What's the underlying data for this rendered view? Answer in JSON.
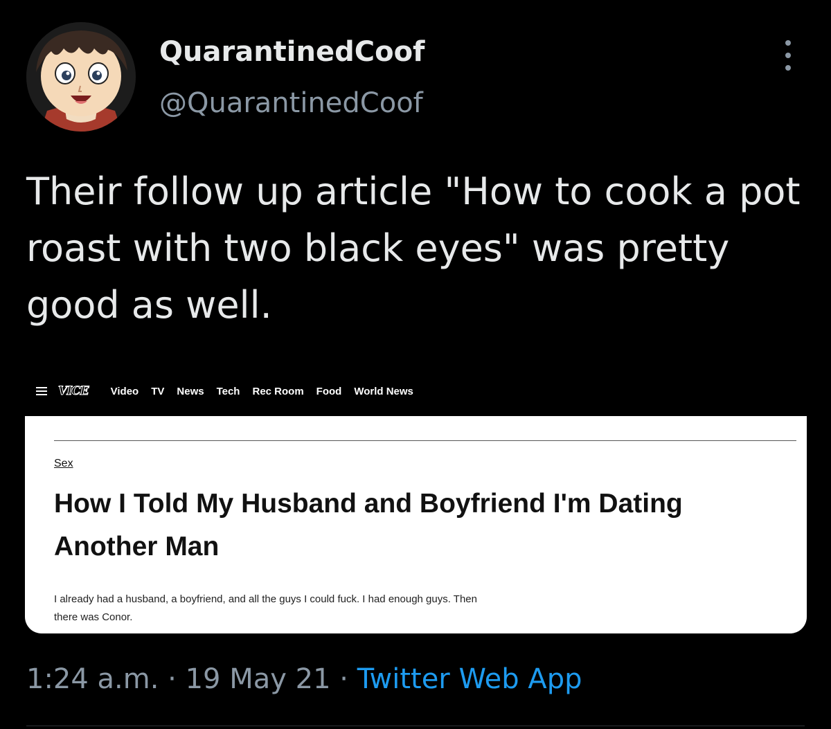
{
  "tweet": {
    "display_name": "QuarantinedCoof",
    "handle": "@QuarantinedCoof",
    "text": "Their follow up article \"How to cook a pot roast with two black eyes\" was pretty good as well.",
    "timestamp": "1:24 a.m.",
    "separator": "·",
    "date": "19 May 21",
    "source": "Twitter Web App"
  },
  "embedded_screenshot": {
    "logo": "VICE",
    "nav_items": [
      "Video",
      "TV",
      "News",
      "Tech",
      "Rec Room",
      "Food",
      "World News"
    ],
    "category": "Sex",
    "headline": "How I Told My Husband and Boyfriend I'm Dating Another Man",
    "dek": "I already had a husband, a boyfriend, and all the guys I could fuck. I had enough guys. Then there was Conor."
  },
  "icons": {
    "more": "more-vertical-icon",
    "menu": "hamburger-menu-icon",
    "avatar": "anime-boy-avatar"
  },
  "colors": {
    "background": "#000000",
    "primary_text": "#e7e9ea",
    "secondary_text": "#8b98a5",
    "link": "#1d9bf0",
    "card_background": "#ffffff"
  }
}
